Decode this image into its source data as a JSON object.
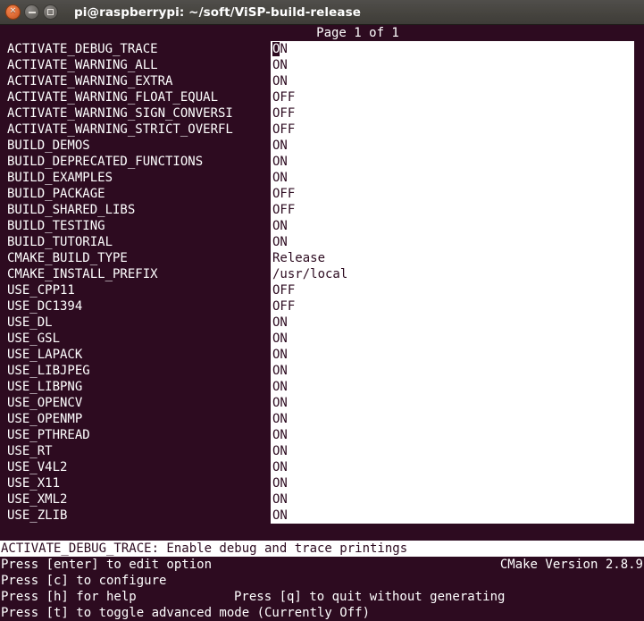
{
  "window": {
    "title": "pi@raspberrypi: ~/soft/ViSP-build-release",
    "buttons": {
      "close": "close-button",
      "minimize": "minimize-button",
      "maximize": "maximize-button"
    }
  },
  "terminal": {
    "page_indicator": "Page 1 of 1",
    "entries": [
      {
        "key": "ACTIVATE_DEBUG_TRACE",
        "value": "ON"
      },
      {
        "key": "ACTIVATE_WARNING_ALL",
        "value": "ON"
      },
      {
        "key": "ACTIVATE_WARNING_EXTRA",
        "value": "ON"
      },
      {
        "key": "ACTIVATE_WARNING_FLOAT_EQUAL",
        "value": "OFF"
      },
      {
        "key": "ACTIVATE_WARNING_SIGN_CONVERSI",
        "value": "OFF"
      },
      {
        "key": "ACTIVATE_WARNING_STRICT_OVERFL",
        "value": "OFF"
      },
      {
        "key": "BUILD_DEMOS",
        "value": "ON"
      },
      {
        "key": "BUILD_DEPRECATED_FUNCTIONS",
        "value": "ON"
      },
      {
        "key": "BUILD_EXAMPLES",
        "value": "ON"
      },
      {
        "key": "BUILD_PACKAGE",
        "value": "OFF"
      },
      {
        "key": "BUILD_SHARED_LIBS",
        "value": "OFF"
      },
      {
        "key": "BUILD_TESTING",
        "value": "ON"
      },
      {
        "key": "BUILD_TUTORIAL",
        "value": "ON"
      },
      {
        "key": "CMAKE_BUILD_TYPE",
        "value": "Release"
      },
      {
        "key": "CMAKE_INSTALL_PREFIX",
        "value": "/usr/local"
      },
      {
        "key": "USE_CPP11",
        "value": "OFF"
      },
      {
        "key": "USE_DC1394",
        "value": "OFF"
      },
      {
        "key": "USE_DL",
        "value": "ON"
      },
      {
        "key": "USE_GSL",
        "value": "ON"
      },
      {
        "key": "USE_LAPACK",
        "value": "ON"
      },
      {
        "key": "USE_LIBJPEG",
        "value": "ON"
      },
      {
        "key": "USE_LIBPNG",
        "value": "ON"
      },
      {
        "key": "USE_OPENCV",
        "value": "ON"
      },
      {
        "key": "USE_OPENMP",
        "value": "ON"
      },
      {
        "key": "USE_PTHREAD",
        "value": "ON"
      },
      {
        "key": "USE_RT",
        "value": "ON"
      },
      {
        "key": "USE_V4L2",
        "value": "ON"
      },
      {
        "key": "USE_X11",
        "value": "ON"
      },
      {
        "key": "USE_XML2",
        "value": "ON"
      },
      {
        "key": "USE_ZLIB",
        "value": "ON"
      }
    ],
    "selected_index": 0,
    "help_line": "ACTIVATE_DEBUG_TRACE: Enable debug and trace printings",
    "commands": [
      {
        "left": "Press [enter] to edit option",
        "mid": "",
        "right": "CMake Version 2.8.9"
      },
      {
        "left": "Press [c] to configure",
        "mid": "",
        "right": ""
      },
      {
        "left": "Press [h] for help",
        "mid": "Press [q] to quit without generating",
        "right": ""
      },
      {
        "left": "Press [t] to toggle advanced mode (Currently Off)",
        "mid": "",
        "right": ""
      }
    ]
  },
  "colors": {
    "terminal_bg": "#2d0b20",
    "terminal_fg": "#ffffff",
    "value_bg": "#ffffff",
    "value_fg": "#2d0b20",
    "titlebar_bg": "#46443f",
    "close_button": "#e2703a"
  }
}
